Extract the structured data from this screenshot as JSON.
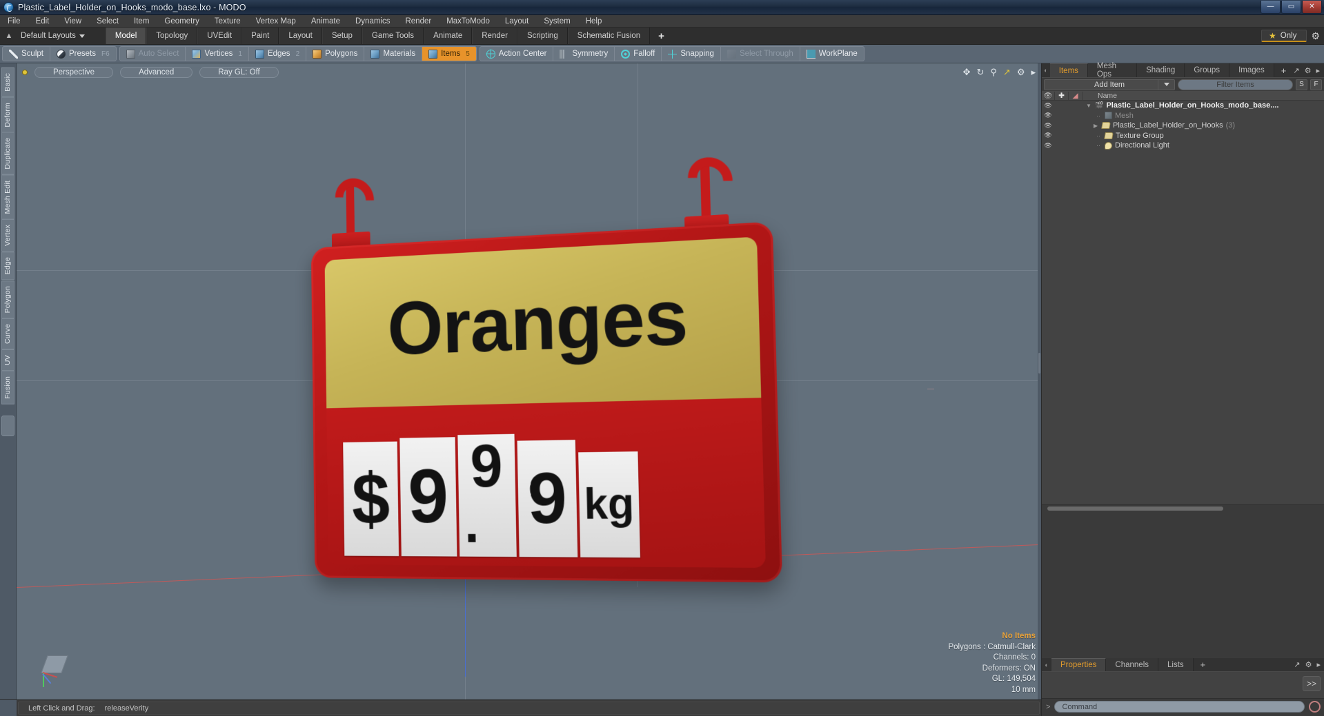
{
  "window": {
    "title": "Plastic_Label_Holder_on_Hooks_modo_base.lxo - MODO",
    "app_icon": "modo-app-icon",
    "buttons": {
      "minimize": "—",
      "maximize": "▭",
      "close": "✕"
    }
  },
  "menubar": {
    "items": [
      "File",
      "Edit",
      "View",
      "Select",
      "Item",
      "Geometry",
      "Texture",
      "Vertex Map",
      "Animate",
      "Dynamics",
      "Render",
      "MaxToModo",
      "Layout",
      "System",
      "Help"
    ]
  },
  "layoutrow": {
    "home_icon": "home-icon",
    "default_layouts": "Default Layouts",
    "tabs": [
      "Model",
      "Topology",
      "UVEdit",
      "Paint",
      "Layout",
      "Setup",
      "Game Tools",
      "Animate",
      "Render",
      "Scripting",
      "Schematic Fusion"
    ],
    "active_tab": "Model",
    "plus": "+",
    "only_label": "Only",
    "star_icon": "star-icon",
    "gear_icon": "gear-icon",
    "accent": "#c79019"
  },
  "modebar": {
    "groups": [
      {
        "items": [
          {
            "label": "Sculpt",
            "icon": "brush-icon",
            "state": "normal",
            "key": ""
          },
          {
            "label": "Presets",
            "icon": "sphere-icon",
            "state": "normal",
            "key": "F6"
          }
        ]
      },
      {
        "items": [
          {
            "label": "Auto Select",
            "icon": "cube-gray-icon",
            "state": "dim",
            "key": ""
          },
          {
            "label": "Vertices",
            "icon": "cube-vertex-icon",
            "state": "normal",
            "key": "1"
          },
          {
            "label": "Edges",
            "icon": "cube-edge-icon",
            "state": "normal",
            "key": "2"
          },
          {
            "label": "Polygons",
            "icon": "cube-polygon-icon",
            "state": "normal",
            "key": ""
          },
          {
            "label": "Materials",
            "icon": "cube-material-icon",
            "state": "normal",
            "key": ""
          },
          {
            "label": "Items",
            "icon": "cube-item-icon",
            "state": "active",
            "key": "5"
          }
        ]
      },
      {
        "items": [
          {
            "label": "Action Center",
            "icon": "action-center-icon",
            "state": "normal",
            "key": ""
          },
          {
            "label": "Symmetry",
            "icon": "symmetry-icon",
            "state": "normal",
            "key": ""
          },
          {
            "label": "Falloff",
            "icon": "falloff-icon",
            "state": "normal",
            "key": ""
          },
          {
            "label": "Snapping",
            "icon": "snapping-icon",
            "state": "normal",
            "key": ""
          },
          {
            "label": "Select Through",
            "icon": "select-through-icon",
            "state": "dim",
            "key": ""
          },
          {
            "label": "WorkPlane",
            "icon": "workplane-icon",
            "state": "normal",
            "key": ""
          }
        ]
      }
    ]
  },
  "left_strip": {
    "tabs": [
      "Basic",
      "Deform",
      "Duplicate",
      "Mesh Edit",
      "Vertex",
      "Edge",
      "Polygon",
      "Curve",
      "UV",
      "Fusion"
    ]
  },
  "viewport": {
    "header": {
      "indicator": "viewport-active-dot",
      "view_mode": "Perspective",
      "shading": "Advanced",
      "raygl": "Ray GL: Off",
      "icons": [
        "move-icon",
        "rotate-icon",
        "zoom-icon",
        "fit-icon",
        "gear-icon",
        "chevron-right-icon"
      ]
    },
    "info": {
      "selection": "No Items",
      "polygons": "Polygons : Catmull-Clark",
      "channels": "Channels: 0",
      "deformers": "Deformers: ON",
      "gl": "GL: 149,504",
      "grid": "10 mm"
    },
    "model": {
      "name": "plastic-label-holder-sign",
      "header_text": "Oranges",
      "price_tiles": [
        "$",
        "9",
        "9",
        "9",
        "kg"
      ],
      "decimal_point": ".",
      "frame_color": "#c01a1a",
      "header_bg_color": "#c6b457",
      "tile_color": "#eaeaea",
      "background_color": "#63707c"
    }
  },
  "right_panel": {
    "tabs": [
      "Items",
      "Mesh Ops",
      "Shading",
      "Groups",
      "Images"
    ],
    "active_tab": "Items",
    "plus": "+",
    "toolbar": {
      "add_item": "Add Item",
      "filter_placeholder": "Filter Items",
      "btn_s": "S",
      "btn_f": "F"
    },
    "tree_header": {
      "eye": "eye-icon",
      "col2": "lock-icon",
      "col3": "render-icon",
      "name": "Name"
    },
    "tree": [
      {
        "label": "Plastic_Label_Holder_on_Hooks_modo_base....",
        "icon": "scene-icon",
        "depth": 0,
        "twirl": "down",
        "style": "bold",
        "count": ""
      },
      {
        "label": "Mesh",
        "icon": "mesh-icon",
        "depth": 1,
        "twirl": "none",
        "style": "dim",
        "count": ""
      },
      {
        "label": "Plastic_Label_Holder_on_Hooks",
        "icon": "folder-icon",
        "depth": 1,
        "twirl": "right",
        "style": "normal",
        "count": "(3)"
      },
      {
        "label": "Texture Group",
        "icon": "folder-icon",
        "depth": 1,
        "twirl": "none",
        "style": "normal",
        "count": ""
      },
      {
        "label": "Directional Light",
        "icon": "light-icon",
        "depth": 1,
        "twirl": "none",
        "style": "normal",
        "count": ""
      }
    ]
  },
  "properties_panel": {
    "tabs": [
      "Properties",
      "Channels",
      "Lists"
    ],
    "active_tab": "Properties",
    "plus": "+",
    "expand_button": ">>"
  },
  "command_bar": {
    "prompt": ">",
    "placeholder": "Command",
    "record_icon": "record-icon"
  },
  "statusbar": {
    "hint_action": "Left Click and Drag:",
    "hint_command": "releaseVerity"
  }
}
